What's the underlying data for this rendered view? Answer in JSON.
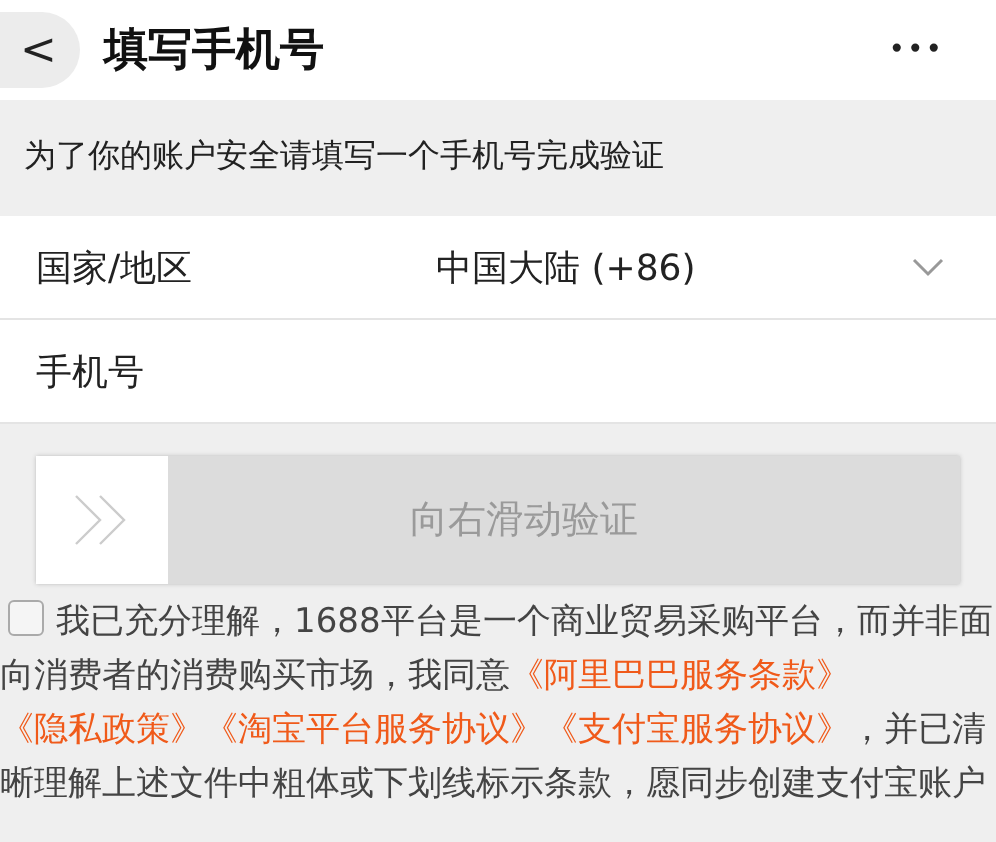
{
  "header": {
    "back": "<",
    "title": "填写手机号",
    "more": "•••"
  },
  "notice": "为了你的账户安全请填写一个手机号完成验证",
  "form_rows": [
    {
      "label": "国家/地区",
      "value": "中国大陆 (+86)",
      "kind": "select"
    },
    {
      "label": "手机号",
      "kind": "input"
    }
  ],
  "slider": {
    "label": "向右滑动验证"
  },
  "agreement": {
    "checked": false,
    "segments": [
      {
        "kind": "text",
        "text": "我已充分理解，1688平台是一个商业贸易采购平台，而并非面向消费者的消费购买市场，我同意"
      },
      {
        "kind": "link",
        "text": "《阿里巴巴服务条款》"
      },
      {
        "kind": "link",
        "text": "《隐私政策》"
      },
      {
        "kind": "link",
        "text": "《淘宝平台服务协议》"
      },
      {
        "kind": "link",
        "text": "《支付宝服务协议》"
      },
      {
        "kind": "text",
        "text": "，并已清晰理解上述文件中粗体或下划线标示条款，愿同步创建支付宝账户"
      }
    ]
  }
}
